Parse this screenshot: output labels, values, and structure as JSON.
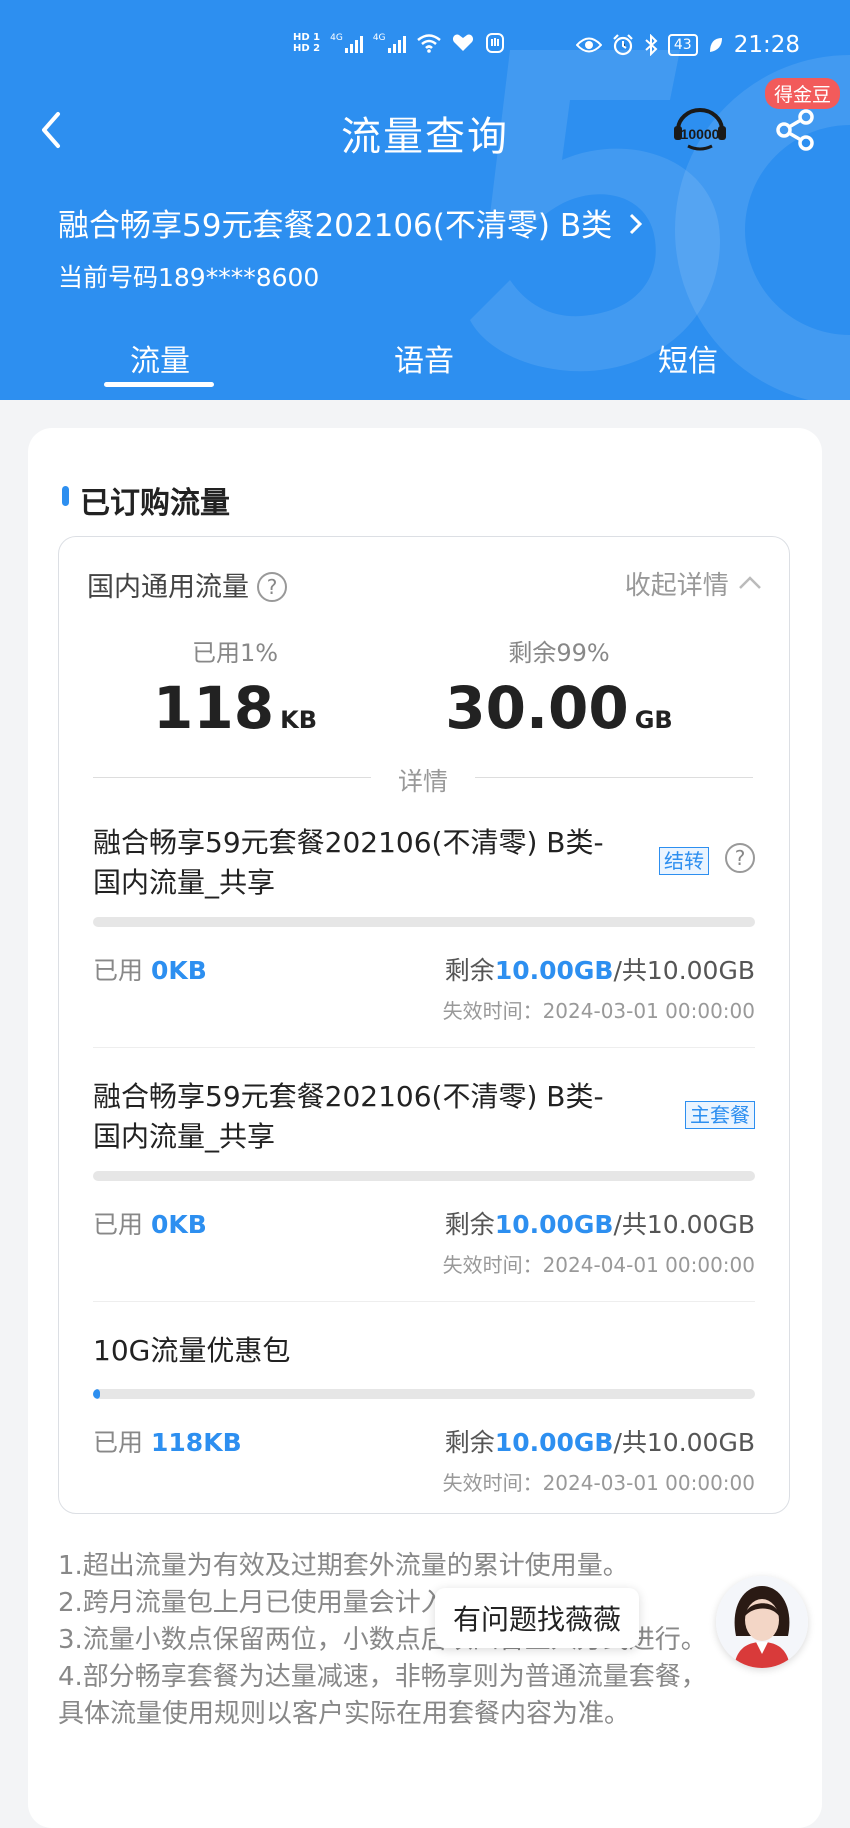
{
  "status_bar": {
    "hd1": "HD 1",
    "hd2": "HD 2",
    "sig1": "4G",
    "sig2": "4G",
    "battery": "43",
    "time": "21:28"
  },
  "header": {
    "title": "流量查询",
    "badge": "得金豆",
    "plan_name": "融合畅享59元套餐202106(不清零) B类",
    "phone": "当前号码189****8600",
    "hotline": "10000"
  },
  "tabs": [
    "流量",
    "语音",
    "短信"
  ],
  "section": {
    "title": "已订购流量",
    "domestic_label": "国内通用流量",
    "collapse_label": "收起详情",
    "used_label": "已用1%",
    "used_value": "118",
    "used_unit": "KB",
    "remain_label": "剩余99%",
    "remain_value": "30.00",
    "remain_unit": "GB",
    "detail_label": "详情"
  },
  "packages": [
    {
      "name": "融合畅享59元套餐202106(不清零) B类-国内流量_共享",
      "tag": "结转",
      "used_label": "已用",
      "used": "0KB",
      "remain_prefix": "剩余",
      "remain": "10.00GB",
      "total": "/共10.00GB",
      "expire": "失效时间：2024-03-01 00:00:00",
      "usage_fraction": 0
    },
    {
      "name": "融合畅享59元套餐202106(不清零) B类-国内流量_共享",
      "tag": "主套餐",
      "used_label": "已用",
      "used": "0KB",
      "remain_prefix": "剩余",
      "remain": "10.00GB",
      "total": "/共10.00GB",
      "expire": "失效时间：2024-04-01 00:00:00",
      "usage_fraction": 0
    },
    {
      "name": "10G流量优惠包",
      "used_label": "已用",
      "used": "118KB",
      "remain_prefix": "剩余",
      "remain": "10.00GB",
      "total": "/共10.00GB",
      "expire": "失效时间：2024-03-01 00:00:00",
      "usage_fraction": 0.01
    }
  ],
  "notes": [
    "1.超出流量为有效及过期套外流量的累计使用量。",
    "2.跨月流量包上月已使用量会计入本月已使用量中。",
    "3.流量小数点保留两位，小数点后以四舍五入方式进行。",
    "4.部分畅享套餐为达量减速，非畅享则为普通流量套餐，",
    "具体流量使用规则以客户实际在用套餐内容为准。"
  ],
  "help": {
    "bubble": "有问题找薇薇"
  },
  "colors": {
    "brand_blue": "#2d8ff0",
    "badge_red": "#f25b5b"
  }
}
